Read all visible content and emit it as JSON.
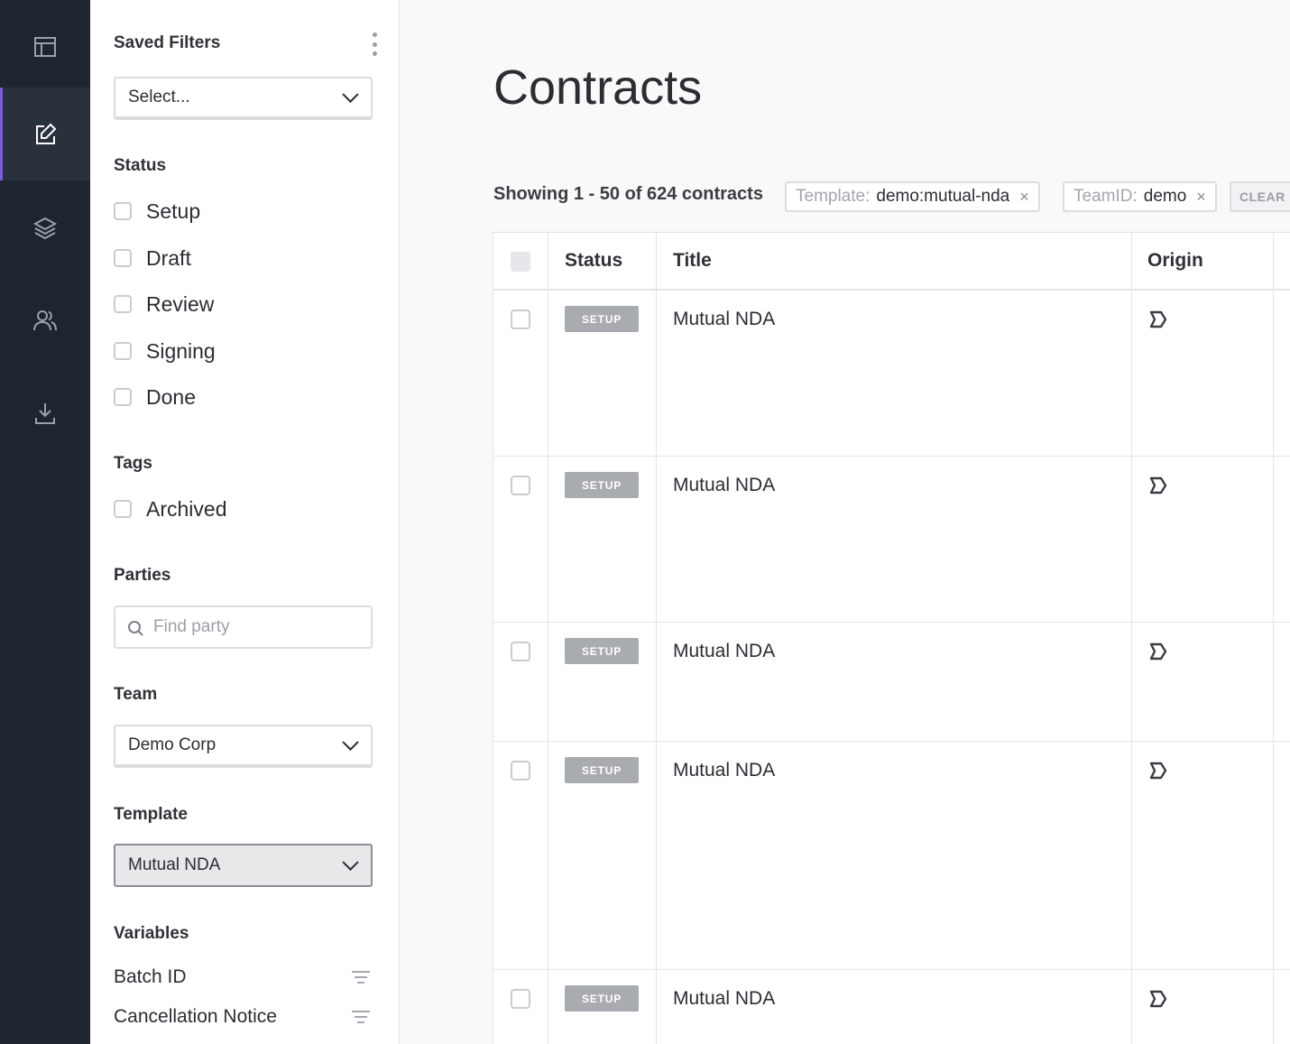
{
  "nav": {
    "items": [
      {
        "name": "dashboard",
        "icon": "layout-icon",
        "active": false
      },
      {
        "name": "contracts",
        "icon": "edit-icon",
        "active": true
      },
      {
        "name": "templates",
        "icon": "layers-icon",
        "active": false
      },
      {
        "name": "users",
        "icon": "users-icon",
        "active": false
      },
      {
        "name": "downloads",
        "icon": "download-icon",
        "active": false
      }
    ]
  },
  "filters": {
    "saved_filters": {
      "title": "Saved Filters",
      "value": "Select..."
    },
    "status": {
      "title": "Status",
      "options": [
        "Setup",
        "Draft",
        "Review",
        "Signing",
        "Done"
      ]
    },
    "tags": {
      "title": "Tags",
      "options": [
        "Archived"
      ]
    },
    "parties": {
      "title": "Parties",
      "placeholder": "Find party"
    },
    "team": {
      "title": "Team",
      "value": "Demo Corp"
    },
    "template": {
      "title": "Template",
      "value": "Mutual NDA"
    },
    "variables": {
      "title": "Variables",
      "items": [
        "Batch ID",
        "Cancellation Notice"
      ]
    }
  },
  "main": {
    "title": "Contracts",
    "showing": "Showing 1 - 50 of 624 contracts",
    "chips": [
      {
        "key": "Template:",
        "value": "demo:mutual-nda",
        "close": "×"
      },
      {
        "key": "TeamID:",
        "value": "demo",
        "close": "×"
      }
    ],
    "clear_label": "CLEAR",
    "table": {
      "columns": [
        "Status",
        "Title",
        "Origin"
      ],
      "rows": [
        {
          "status": "SETUP",
          "title": "Mutual NDA"
        },
        {
          "status": "SETUP",
          "title": "Mutual NDA"
        },
        {
          "status": "SETUP",
          "title": "Mutual NDA"
        },
        {
          "status": "SETUP",
          "title": "Mutual NDA"
        },
        {
          "status": "SETUP",
          "title": "Mutual NDA"
        }
      ]
    }
  },
  "colors": {
    "rail_bg": "#1e252e",
    "accent": "#7c5ce0",
    "badge_bg": "#a8abb0"
  }
}
